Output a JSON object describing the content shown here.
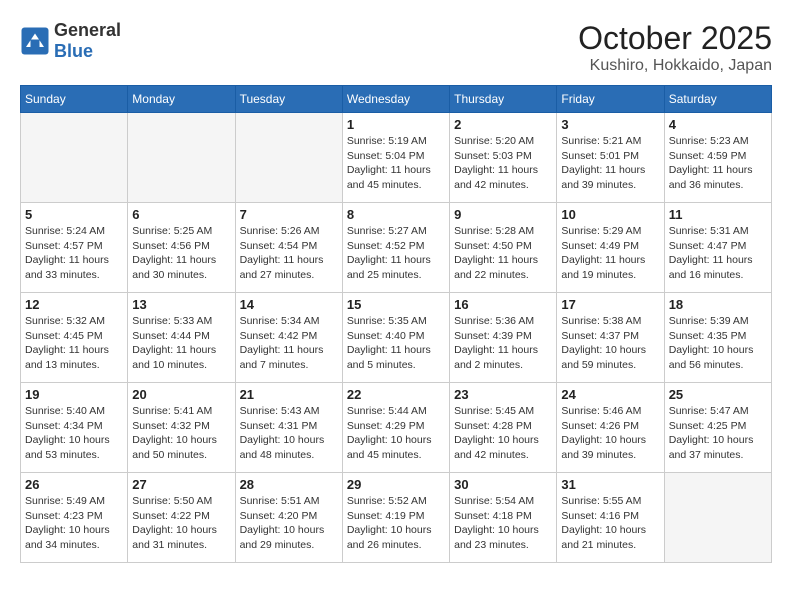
{
  "header": {
    "logo_general": "General",
    "logo_blue": "Blue",
    "month": "October 2025",
    "location": "Kushiro, Hokkaido, Japan"
  },
  "weekdays": [
    "Sunday",
    "Monday",
    "Tuesday",
    "Wednesday",
    "Thursday",
    "Friday",
    "Saturday"
  ],
  "weeks": [
    [
      {
        "day": "",
        "info": ""
      },
      {
        "day": "",
        "info": ""
      },
      {
        "day": "",
        "info": ""
      },
      {
        "day": "1",
        "info": "Sunrise: 5:19 AM\nSunset: 5:04 PM\nDaylight: 11 hours and 45 minutes."
      },
      {
        "day": "2",
        "info": "Sunrise: 5:20 AM\nSunset: 5:03 PM\nDaylight: 11 hours and 42 minutes."
      },
      {
        "day": "3",
        "info": "Sunrise: 5:21 AM\nSunset: 5:01 PM\nDaylight: 11 hours and 39 minutes."
      },
      {
        "day": "4",
        "info": "Sunrise: 5:23 AM\nSunset: 4:59 PM\nDaylight: 11 hours and 36 minutes."
      }
    ],
    [
      {
        "day": "5",
        "info": "Sunrise: 5:24 AM\nSunset: 4:57 PM\nDaylight: 11 hours and 33 minutes."
      },
      {
        "day": "6",
        "info": "Sunrise: 5:25 AM\nSunset: 4:56 PM\nDaylight: 11 hours and 30 minutes."
      },
      {
        "day": "7",
        "info": "Sunrise: 5:26 AM\nSunset: 4:54 PM\nDaylight: 11 hours and 27 minutes."
      },
      {
        "day": "8",
        "info": "Sunrise: 5:27 AM\nSunset: 4:52 PM\nDaylight: 11 hours and 25 minutes."
      },
      {
        "day": "9",
        "info": "Sunrise: 5:28 AM\nSunset: 4:50 PM\nDaylight: 11 hours and 22 minutes."
      },
      {
        "day": "10",
        "info": "Sunrise: 5:29 AM\nSunset: 4:49 PM\nDaylight: 11 hours and 19 minutes."
      },
      {
        "day": "11",
        "info": "Sunrise: 5:31 AM\nSunset: 4:47 PM\nDaylight: 11 hours and 16 minutes."
      }
    ],
    [
      {
        "day": "12",
        "info": "Sunrise: 5:32 AM\nSunset: 4:45 PM\nDaylight: 11 hours and 13 minutes."
      },
      {
        "day": "13",
        "info": "Sunrise: 5:33 AM\nSunset: 4:44 PM\nDaylight: 11 hours and 10 minutes."
      },
      {
        "day": "14",
        "info": "Sunrise: 5:34 AM\nSunset: 4:42 PM\nDaylight: 11 hours and 7 minutes."
      },
      {
        "day": "15",
        "info": "Sunrise: 5:35 AM\nSunset: 4:40 PM\nDaylight: 11 hours and 5 minutes."
      },
      {
        "day": "16",
        "info": "Sunrise: 5:36 AM\nSunset: 4:39 PM\nDaylight: 11 hours and 2 minutes."
      },
      {
        "day": "17",
        "info": "Sunrise: 5:38 AM\nSunset: 4:37 PM\nDaylight: 10 hours and 59 minutes."
      },
      {
        "day": "18",
        "info": "Sunrise: 5:39 AM\nSunset: 4:35 PM\nDaylight: 10 hours and 56 minutes."
      }
    ],
    [
      {
        "day": "19",
        "info": "Sunrise: 5:40 AM\nSunset: 4:34 PM\nDaylight: 10 hours and 53 minutes."
      },
      {
        "day": "20",
        "info": "Sunrise: 5:41 AM\nSunset: 4:32 PM\nDaylight: 10 hours and 50 minutes."
      },
      {
        "day": "21",
        "info": "Sunrise: 5:43 AM\nSunset: 4:31 PM\nDaylight: 10 hours and 48 minutes."
      },
      {
        "day": "22",
        "info": "Sunrise: 5:44 AM\nSunset: 4:29 PM\nDaylight: 10 hours and 45 minutes."
      },
      {
        "day": "23",
        "info": "Sunrise: 5:45 AM\nSunset: 4:28 PM\nDaylight: 10 hours and 42 minutes."
      },
      {
        "day": "24",
        "info": "Sunrise: 5:46 AM\nSunset: 4:26 PM\nDaylight: 10 hours and 39 minutes."
      },
      {
        "day": "25",
        "info": "Sunrise: 5:47 AM\nSunset: 4:25 PM\nDaylight: 10 hours and 37 minutes."
      }
    ],
    [
      {
        "day": "26",
        "info": "Sunrise: 5:49 AM\nSunset: 4:23 PM\nDaylight: 10 hours and 34 minutes."
      },
      {
        "day": "27",
        "info": "Sunrise: 5:50 AM\nSunset: 4:22 PM\nDaylight: 10 hours and 31 minutes."
      },
      {
        "day": "28",
        "info": "Sunrise: 5:51 AM\nSunset: 4:20 PM\nDaylight: 10 hours and 29 minutes."
      },
      {
        "day": "29",
        "info": "Sunrise: 5:52 AM\nSunset: 4:19 PM\nDaylight: 10 hours and 26 minutes."
      },
      {
        "day": "30",
        "info": "Sunrise: 5:54 AM\nSunset: 4:18 PM\nDaylight: 10 hours and 23 minutes."
      },
      {
        "day": "31",
        "info": "Sunrise: 5:55 AM\nSunset: 4:16 PM\nDaylight: 10 hours and 21 minutes."
      },
      {
        "day": "",
        "info": ""
      }
    ]
  ]
}
